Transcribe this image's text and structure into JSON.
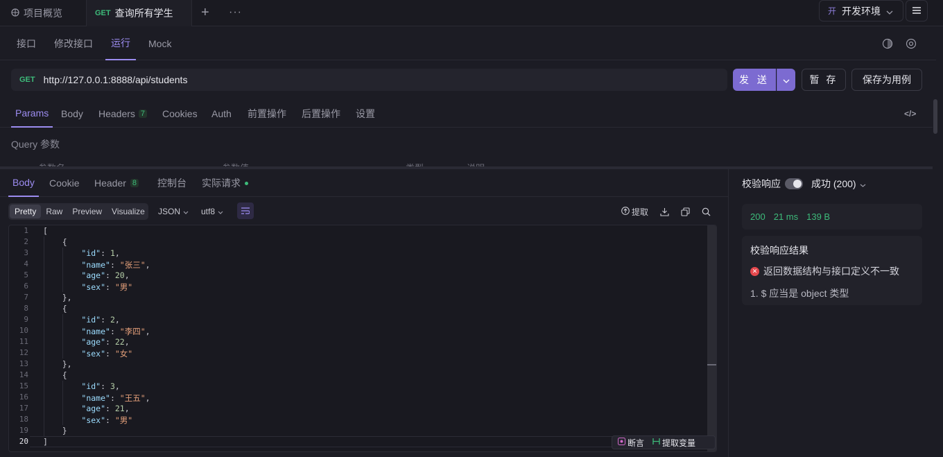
{
  "tabs": {
    "overview_label": "项目概览",
    "active_method": "GET",
    "active_label": "查询所有学生",
    "add": "+",
    "more": "···"
  },
  "env": {
    "badge": "开",
    "label": "开发环境"
  },
  "subnav": {
    "items": [
      "接口",
      "修改接口",
      "运行",
      "Mock"
    ],
    "active": "运行"
  },
  "request": {
    "method": "GET",
    "url": "http://127.0.0.1:8888/api/students",
    "send_label": "发 送",
    "save_label": "暂 存",
    "save_case_label": "保存为用例"
  },
  "param_tabs": {
    "items": [
      "Params",
      "Body",
      "Headers",
      "Cookies",
      "Auth",
      "前置操作",
      "后置操作",
      "设置"
    ],
    "headers_count": "7",
    "code_icon": "</>"
  },
  "query": {
    "title": "Query 参数",
    "columns": [
      "参数名",
      "参数值",
      "类型",
      "说明"
    ]
  },
  "response_tabs": {
    "items": [
      "Body",
      "Cookie",
      "Header",
      "控制台",
      "实际请求"
    ],
    "header_count": "8"
  },
  "viewer": {
    "modes": [
      "Pretty",
      "Raw",
      "Preview",
      "Visualize"
    ],
    "format": "JSON",
    "encoding": "utf8",
    "extract_label": "提取"
  },
  "code_lines": [
    "[",
    "    {",
    "        \"id\": 1,",
    "        \"name\": \"张三\",",
    "        \"age\": 20,",
    "        \"sex\": \"男\"",
    "    },",
    "    {",
    "        \"id\": 2,",
    "        \"name\": \"李四\",",
    "        \"age\": 22,",
    "        \"sex\": \"女\"",
    "    },",
    "    {",
    "        \"id\": 3,",
    "        \"name\": \"王五\",",
    "        \"age\": 21,",
    "        \"sex\": \"男\"",
    "    }",
    "]"
  ],
  "float_bar": {
    "assert_label": "断言",
    "extract_var_label": "提取变量"
  },
  "verify": {
    "label": "校验响应",
    "status_select": "成功 (200)",
    "status_code": "200",
    "time": "21 ms",
    "size": "139 B",
    "result_title": "校验响应结果",
    "error_message": "返回数据结构与接口定义不一致",
    "detail": "1. $ 应当是 object 类型"
  },
  "colors": {
    "accent": "#9c8cf0",
    "send": "#7c6bd1",
    "success": "#3dbb7a",
    "error": "#e5484d"
  }
}
